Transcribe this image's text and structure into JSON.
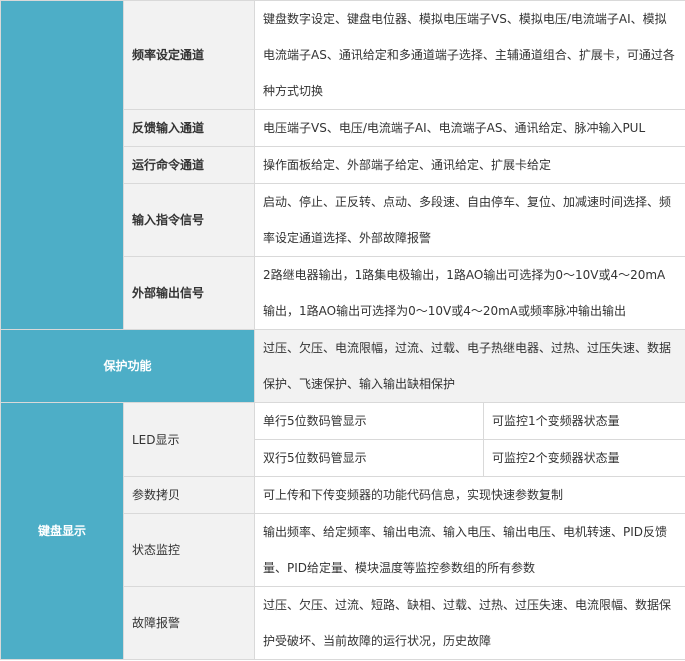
{
  "table": {
    "rows": [
      {
        "cat": "",
        "sub": "频率设定通道",
        "val": "键盘数字设定、键盘电位器、模拟电压端子VS、模拟电压/电流端子AI、模拟电流端子AS、通讯给定和多通道端子选择、主辅通道组合、扩展卡，可通过各种方式切换"
      },
      {
        "sub": "反馈输入通道",
        "val": "电压端子VS、电压/电流端子AI、电流端子AS、通讯给定、脉冲输入PUL"
      },
      {
        "sub": "运行命令通道",
        "val": "操作面板给定、外部端子给定、通讯给定、扩展卡给定"
      },
      {
        "sub": "输入指令信号",
        "val": "启动、停止、正反转、点动、多段速、自由停车、复位、加减速时间选择、频率设定通道选择、外部故障报警"
      },
      {
        "sub": "外部输出信号",
        "val": "2路继电器输出，1路集电极输出，1路AO输出可选择为0～10V或4～20mA输出，1路AO输出可选择为0～10V或4～20mA或频率脉冲输出输出"
      }
    ],
    "protection": {
      "cat": "保护功能",
      "val": "过压、欠压、电流限幅，过流、过载、电子热继电器、过热、过压失速、数据保护、飞速保护、输入输出缺相保护"
    },
    "keyboard": {
      "cat": "键盘显示",
      "led": {
        "sub": "LED显示",
        "row1": {
          "a": "单行5位数码管显示",
          "b": "可监控1个变频器状态量"
        },
        "row2": {
          "a": "双行5位数码管显示",
          "b": "可监控2个变频器状态量"
        }
      },
      "copy": {
        "sub": "参数拷贝",
        "val": "可上传和下传变频器的功能代码信息，实现快速参数复制"
      },
      "monitor": {
        "sub": "状态监控",
        "val": "输出频率、给定频率、输出电流、输入电压、输出电压、电机转速、PID反馈量、PID给定量、模块温度等监控参数组的所有参数"
      },
      "fault": {
        "sub": "故障报警",
        "val": "过压、欠压、过流、短路、缺相、过载、过热、过压失速、电流限幅、数据保护受破坏、当前故障的运行状况，历史故障"
      }
    }
  }
}
